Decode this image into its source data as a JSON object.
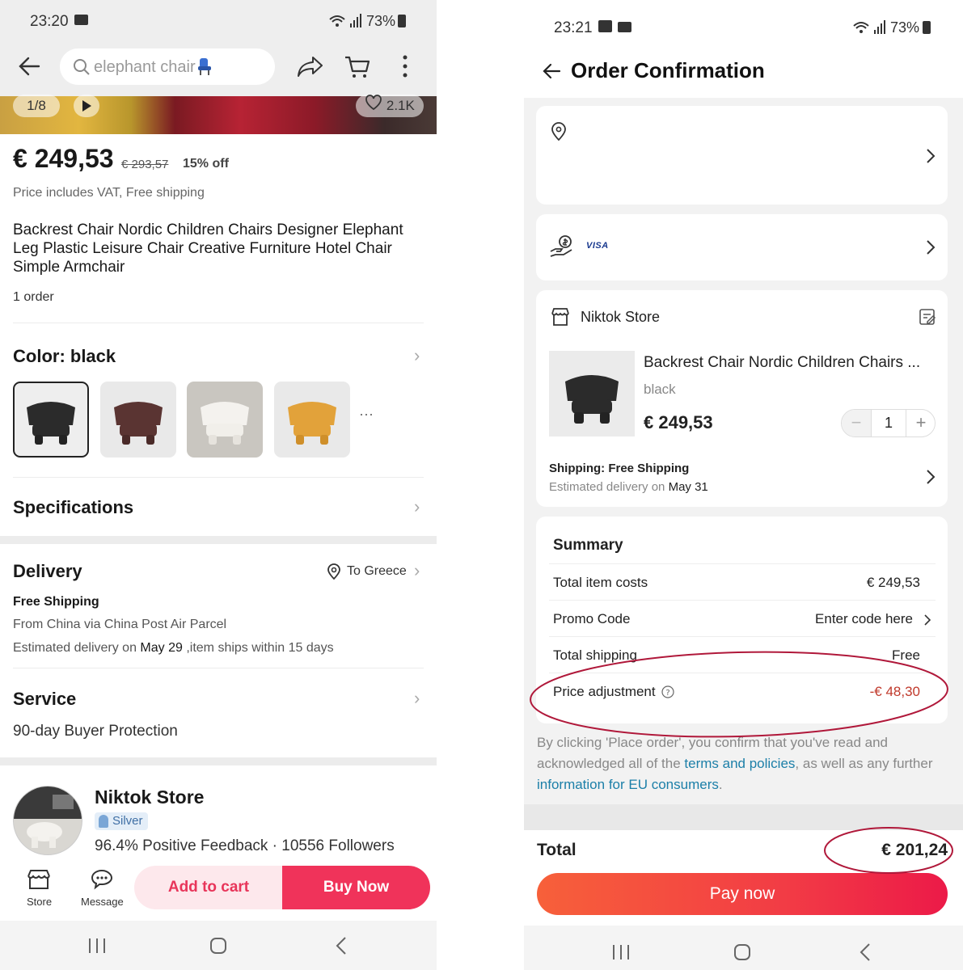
{
  "left": {
    "status_time": "23:20",
    "battery": "73%",
    "search_query": "elephant chair",
    "gallery_counter": "1/8",
    "likes": "2.1K",
    "price": "€ 249,53",
    "price_old": "€ 293,57",
    "discount": "15% off",
    "vat_note": "Price includes VAT, Free shipping",
    "title": "Backrest Chair Nordic Children Chairs Designer Elephant Leg Plastic Leisure Chair Creative Furniture Hotel Chair Simple Armchair",
    "orders": "1 order",
    "color_label": "Color: black",
    "swatch_colors": [
      "#2b2b2b",
      "#5a3432",
      "#f1efea",
      "#e2a23a"
    ],
    "more": "···",
    "specs_label": "Specifications",
    "delivery_label": "Delivery",
    "delivery_dest": "To Greece",
    "free_shipping": "Free Shipping",
    "ship_from": "From China via China Post Air Parcel",
    "est_prefix": "Estimated delivery on ",
    "est_date": "May 29",
    "est_suffix": " ,item ships within 15 days",
    "service_label": "Service",
    "service_value": "90-day Buyer Protection",
    "store_name": "Niktok Store",
    "store_badge": "Silver",
    "store_stats": "96.4% Positive Feedback · 10556 Followers",
    "store_btn": "Store",
    "message_btn": "Message",
    "add_cart": "Add to cart",
    "buy_now": "Buy Now"
  },
  "right": {
    "status_time": "23:21",
    "battery": "73%",
    "page_title": "Order Confirmation",
    "visa": "VISA",
    "store_name": "Niktok Store",
    "item_title": "Backrest Chair Nordic Children Chairs ...",
    "item_variant": "black",
    "item_price": "€ 249,53",
    "qty": "1",
    "shipping_label": "Shipping: Free Shipping",
    "est_prefix": "Estimated delivery on ",
    "est_date": "May 31",
    "summary_title": "Summary",
    "rows": [
      {
        "label": "Total item costs",
        "value": "€ 249,53"
      },
      {
        "label": "Promo Code",
        "value": "Enter code here"
      },
      {
        "label": "Total shipping",
        "value": "Free"
      },
      {
        "label": "Price adjustment",
        "value": "-€ 48,30"
      }
    ],
    "legal_1": "By clicking 'Place order', you confirm that you've read and acknowledged all of the ",
    "legal_link1": "terms and policies",
    "legal_2": ", as well as any further ",
    "legal_link2": "information for EU consumers",
    "legal_3": ".",
    "total_label": "Total",
    "total_value": "€ 201,24",
    "pay_now": "Pay now"
  },
  "colors": {
    "accent": "#f0335a",
    "annotation": "#b0183a",
    "negative": "#c0392b",
    "link": "#1c7fa8"
  }
}
